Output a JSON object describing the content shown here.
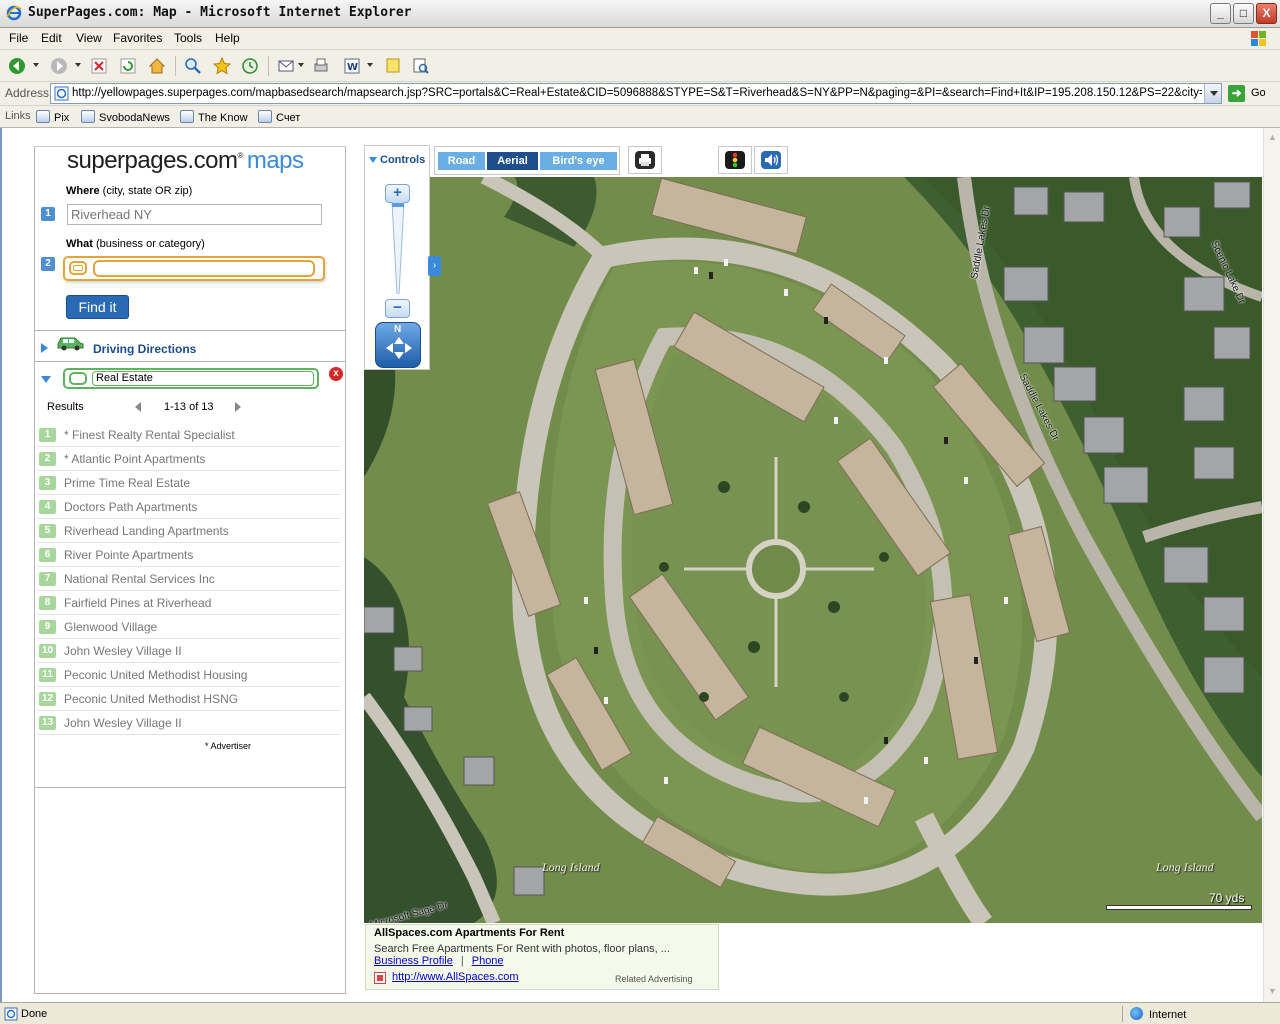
{
  "window": {
    "title": "SuperPages.com: Map - Microsoft Internet Explorer",
    "controls": [
      "_",
      "□",
      "X"
    ]
  },
  "menu": [
    "File",
    "Edit",
    "View",
    "Favorites",
    "Tools",
    "Help"
  ],
  "address": {
    "label": "Address",
    "url": "http://yellowpages.superpages.com/mapbasedsearch/mapsearch.jsp?SRC=portals&C=Real+Estate&CID=5096888&STYPE=S&T=Riverhead&S=NY&PP=N&paging=&PI=&search=Find+It&IP=195.208.150.12&PS=22&city=Riverhead&st",
    "go_label": "Go"
  },
  "links": {
    "label": "Links",
    "items": [
      "Pix",
      "SvobodaNews",
      "The Know",
      "Счет"
    ]
  },
  "sidebar": {
    "logo_main": "superpages.com",
    "logo_reg": "®",
    "logo_maps": "maps",
    "where_label_bold": "Where",
    "where_label_rest": " (city, state OR zip)",
    "where_value": "Riverhead NY",
    "what_label_bold": "What",
    "what_label_rest": " (business or category)",
    "what_value": "",
    "step1": "1",
    "step2": "2",
    "find_button": "Find it",
    "driving_directions": "Driving Directions",
    "category": "Real Estate",
    "close_label": "x",
    "results_label": "Results",
    "results_range": "1-13 of 13",
    "results": [
      {
        "num": "1",
        "name": "* Finest Realty Rental Specialist"
      },
      {
        "num": "2",
        "name": "* Atlantic Point Apartments"
      },
      {
        "num": "3",
        "name": "Prime Time Real Estate"
      },
      {
        "num": "4",
        "name": "Doctors Path Apartments"
      },
      {
        "num": "5",
        "name": "Riverhead Landing Apartments"
      },
      {
        "num": "6",
        "name": "River Pointe Apartments"
      },
      {
        "num": "7",
        "name": "National Rental Services Inc"
      },
      {
        "num": "8",
        "name": "Fairfield Pines at Riverhead"
      },
      {
        "num": "9",
        "name": "Glenwood Village"
      },
      {
        "num": "10",
        "name": "John Wesley Village II"
      },
      {
        "num": "11",
        "name": "Peconic United Methodist Housing"
      },
      {
        "num": "12",
        "name": "Peconic United Methodist HSNG"
      },
      {
        "num": "13",
        "name": "John Wesley Village II"
      }
    ],
    "advertiser_note": "* Advertiser"
  },
  "map": {
    "controls_label": "Controls",
    "modes": [
      "Road",
      "Aerial",
      "Bird's eye"
    ],
    "active_mode": "Aerial",
    "zoom_in": "+",
    "zoom_out": "−",
    "compass_n": "N",
    "expand": "›",
    "labels": {
      "long_island_1": "Long Island",
      "long_island_2": "Long Island",
      "street_saddle_1": "Saddle Lakes Dr",
      "street_saddle_2": "Saddle Lakes Dr",
      "street_scenic": "Scenic Lake Dr",
      "street_bottom": "Microsoft Sage Dr"
    },
    "scale_label": "70 yds",
    "colors": {
      "grass": "#6f8a4a",
      "trees": "#2f4a24",
      "road": "#c9c6b9",
      "roof": "#c2b19a"
    }
  },
  "ad": {
    "title": "AllSpaces.com Apartments For Rent",
    "description": "Search Free Apartments For Rent with photos, floor plans, ...",
    "link1": "Business Profile",
    "separator": "|",
    "link2": "Phone",
    "url": "http://www.AllSpaces.com",
    "related": "Related Advertising"
  },
  "status": {
    "text": "Done",
    "zone": "Internet"
  }
}
